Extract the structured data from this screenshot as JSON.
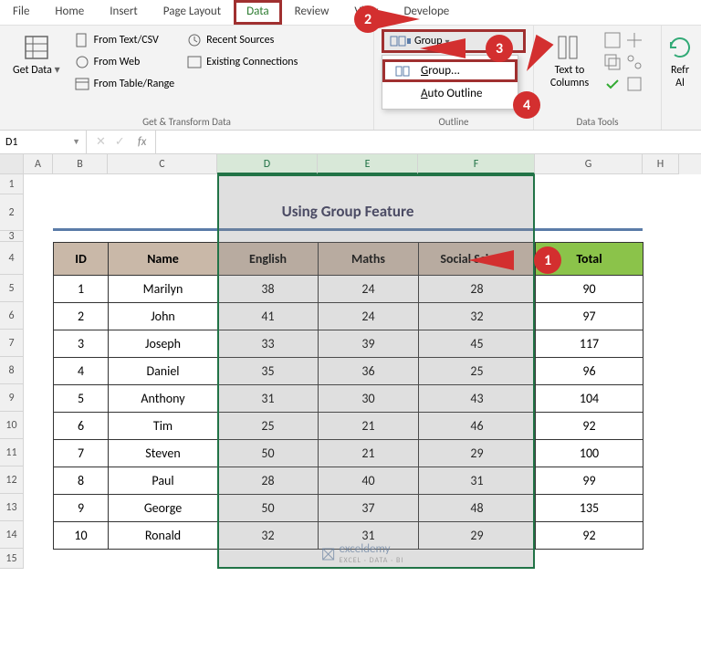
{
  "tabs": [
    "File",
    "Home",
    "Insert",
    "Page Layout",
    "Data",
    "Review",
    "View",
    "Develope"
  ],
  "active_tab_index": 4,
  "ribbon": {
    "get_transform": {
      "label": "Get & Transform Data",
      "get_data": "Get Data",
      "from_text_csv": "From Text/CSV",
      "from_web": "From Web",
      "from_table": "From Table/Range",
      "recent_sources": "Recent Sources",
      "existing_conn": "Existing Connections"
    },
    "outline": {
      "label": "Outline",
      "group": "Group",
      "dropdown": {
        "group": "Group...",
        "auto_outline": "Auto Outline"
      }
    },
    "data_tools": {
      "label": "Data Tools",
      "text_to_columns": "Text to Columns",
      "refresh": "Refr\nAl"
    }
  },
  "name_box": "D1",
  "fx_label": "fx",
  "col_widths": {
    "A": 32,
    "B": 60,
    "C": 120,
    "D": 110,
    "E": 110,
    "F": 128,
    "G": 118,
    "H": 40
  },
  "selected_cols": [
    "D",
    "E",
    "F"
  ],
  "title_cell": "Using Group Feature",
  "headers": [
    "ID",
    "Name",
    "English",
    "Maths",
    "Social Science",
    "Total"
  ],
  "rows": [
    {
      "id": 1,
      "name": "Marilyn",
      "english": 38,
      "maths": 24,
      "ss": 28,
      "total": 90
    },
    {
      "id": 2,
      "name": "John",
      "english": 41,
      "maths": 24,
      "ss": 32,
      "total": 97
    },
    {
      "id": 3,
      "name": "Joseph",
      "english": 33,
      "maths": 39,
      "ss": 45,
      "total": 117
    },
    {
      "id": 4,
      "name": "Daniel",
      "english": 35,
      "maths": 36,
      "ss": 25,
      "total": 96
    },
    {
      "id": 5,
      "name": "Anthony",
      "english": 31,
      "maths": 30,
      "ss": 43,
      "total": 104
    },
    {
      "id": 6,
      "name": "Tim",
      "english": 25,
      "maths": 21,
      "ss": 46,
      "total": 92
    },
    {
      "id": 7,
      "name": "Steven",
      "english": 50,
      "maths": 21,
      "ss": 29,
      "total": 100
    },
    {
      "id": 8,
      "name": "Paul",
      "english": 28,
      "maths": 40,
      "ss": 31,
      "total": 99
    },
    {
      "id": 9,
      "name": "George",
      "english": 50,
      "maths": 37,
      "ss": 48,
      "total": 135
    },
    {
      "id": 10,
      "name": "Ronald",
      "english": 32,
      "maths": 31,
      "ss": 29,
      "total": 92
    }
  ],
  "callouts": {
    "1": "1",
    "2": "2",
    "3": "3",
    "4": "4"
  },
  "watermark": {
    "main": "exceldemy",
    "sub": "EXCEL · DATA · BI"
  },
  "chart_data": {
    "type": "table",
    "title": "Using Group Feature",
    "columns": [
      "ID",
      "Name",
      "English",
      "Maths",
      "Social Science",
      "Total"
    ],
    "data": [
      [
        1,
        "Marilyn",
        38,
        24,
        28,
        90
      ],
      [
        2,
        "John",
        41,
        24,
        32,
        97
      ],
      [
        3,
        "Joseph",
        33,
        39,
        45,
        117
      ],
      [
        4,
        "Daniel",
        35,
        36,
        25,
        96
      ],
      [
        5,
        "Anthony",
        31,
        30,
        43,
        104
      ],
      [
        6,
        "Tim",
        25,
        21,
        46,
        92
      ],
      [
        7,
        "Steven",
        50,
        21,
        29,
        100
      ],
      [
        8,
        "Paul",
        28,
        40,
        31,
        99
      ],
      [
        9,
        "George",
        50,
        37,
        48,
        135
      ],
      [
        10,
        "Ronald",
        32,
        31,
        29,
        92
      ]
    ]
  }
}
